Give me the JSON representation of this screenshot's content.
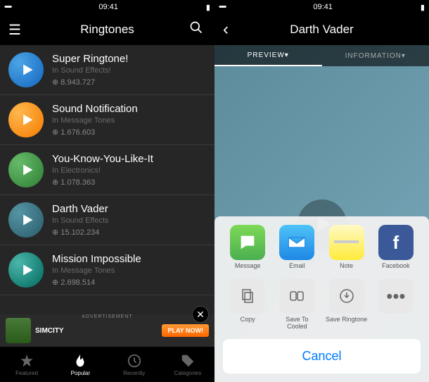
{
  "status": {
    "time": "09:41",
    "signal": "•••••"
  },
  "left": {
    "nav_title": "Ringtones",
    "items": [
      {
        "title": "Super Ringtone!",
        "category": "In Sound Effects!",
        "downloads": "⊕ 8.943.727",
        "color": "bg-blue"
      },
      {
        "title": "Sound Notification",
        "category": "In Message Tones",
        "downloads": "⊕ 1.676.603",
        "color": "bg-orange"
      },
      {
        "title": "You-Know-You-Like-It",
        "category": "In Electronics!",
        "downloads": "⊕ 1.078.363",
        "color": "bg-green"
      },
      {
        "title": "Darth Vader",
        "category": "In Sound Effects",
        "downloads": "⊕ 15.102.234",
        "color": "bg-teal"
      },
      {
        "title": "Mission Impossible",
        "category": "In Message Tones",
        "downloads": "⊕ 2.698.514",
        "color": "bg-cyan"
      }
    ],
    "ad": {
      "label": "ADVERTISEMENT",
      "game": "SIMCITY",
      "button": "PLAY NOW!"
    },
    "tabs": [
      {
        "label": "Featured"
      },
      {
        "label": "Popular"
      },
      {
        "label": "Recently"
      },
      {
        "label": "Categories"
      }
    ]
  },
  "right": {
    "nav_title": "Darth Vader",
    "sub_tabs": {
      "preview": "PREVIEW▾",
      "information": "INFORMATION▾"
    },
    "share": {
      "row1": [
        {
          "label": "Message"
        },
        {
          "label": "Email"
        },
        {
          "label": "Note"
        },
        {
          "label": "Facebook"
        }
      ],
      "row2": [
        {
          "label": "Copy"
        },
        {
          "label": "Save To Cooled"
        },
        {
          "label": "Save Ringtone"
        },
        {
          "label": ""
        }
      ],
      "cancel": "Cancel"
    }
  }
}
